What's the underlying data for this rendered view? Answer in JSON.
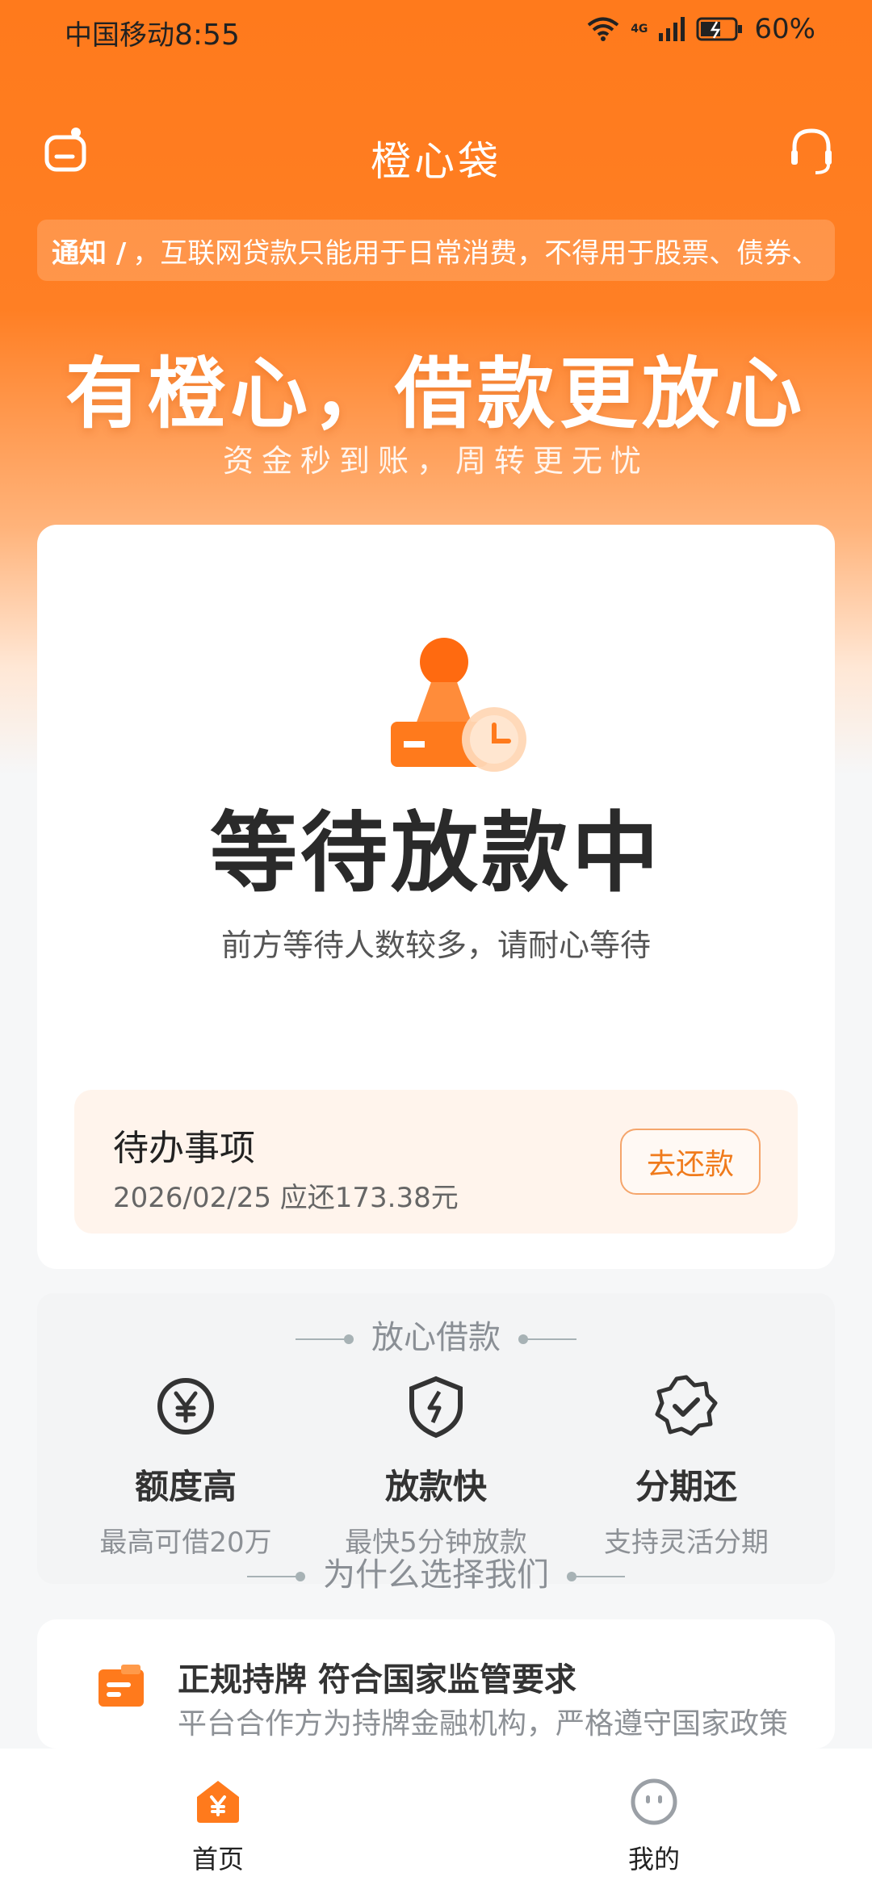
{
  "status_bar": {
    "carrier": "中国移动",
    "time": "8:55",
    "network": "4G",
    "battery": "60%"
  },
  "header": {
    "title": "橙心袋",
    "left_icon": "robot-chat-icon",
    "right_icon": "headset-icon"
  },
  "notice": {
    "tag": "通知 /",
    "text": "，互联网贷款只能用于日常消费，不得用于股票、债券、"
  },
  "slogan": {
    "main": "有橙心，借款更放心",
    "sub": "资金秒到账，周转更无忧"
  },
  "loan_status": {
    "title": "等待放款中",
    "description": "前方等待人数较多，请耐心等待",
    "icon": "waiting-stamp-icon"
  },
  "todo": {
    "title": "待办事项",
    "detail": "2026/02/25 应还173.38元",
    "button": "去还款"
  },
  "features_section": {
    "title": "放心借款",
    "items": [
      {
        "icon": "yuan-icon",
        "name": "额度高",
        "desc": "最高可借20万"
      },
      {
        "icon": "shield-lightning-icon",
        "name": "放款快",
        "desc": "最快5分钟放款"
      },
      {
        "icon": "badge-check-icon",
        "name": "分期还",
        "desc": "支持灵活分期"
      }
    ]
  },
  "why_section": {
    "title": "为什么选择我们",
    "item": {
      "icon": "license-icon",
      "title": "正规持牌  符合国家监管要求",
      "desc": "平台合作方为持牌金融机构，严格遵守国家政策"
    }
  },
  "tabbar": [
    {
      "label": "首页",
      "icon": "home-yuan-icon",
      "active": true
    },
    {
      "label": "我的",
      "icon": "profile-face-icon",
      "active": false
    }
  ],
  "colors": {
    "brand": "#FF7A1C",
    "text_dark": "#2A2A2A",
    "todo_bg": "#FFF4EC"
  }
}
